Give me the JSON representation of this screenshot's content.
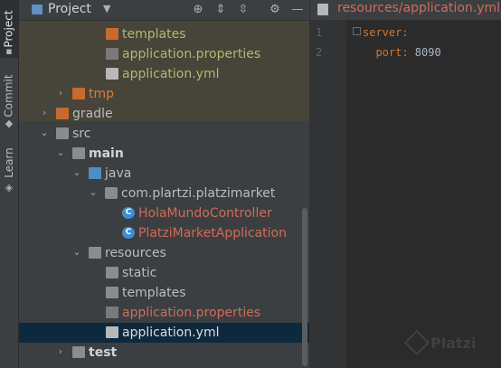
{
  "sidebar_tabs": [
    {
      "label": "Project",
      "active": true
    },
    {
      "label": "Commit",
      "active": false
    },
    {
      "label": "Learn",
      "active": false
    }
  ],
  "panel": {
    "title": "Project",
    "toolbar": [
      "locate-icon",
      "expand-all-icon",
      "collapse-all-icon",
      "gear-icon",
      "hide-icon"
    ]
  },
  "tree": [
    {
      "label": "templates",
      "kind": "folder-orange",
      "color": "olive"
    },
    {
      "label": "application.properties",
      "kind": "props",
      "color": "olive"
    },
    {
      "label": "application.yml",
      "kind": "yml",
      "color": "olive"
    },
    {
      "label": "tmp",
      "kind": "folder-orange",
      "color": "orange"
    },
    {
      "label": "gradle",
      "kind": "folder-orange",
      "color": "normal"
    },
    {
      "label": "src",
      "kind": "folder-gray",
      "color": "normal"
    },
    {
      "label": "main",
      "kind": "folder-blue",
      "color": "bold"
    },
    {
      "label": "java",
      "kind": "folder-blue",
      "color": "normal"
    },
    {
      "label": "com.plartzi.platzimarket",
      "kind": "package",
      "color": "normal"
    },
    {
      "label": "HolaMundoController",
      "kind": "class",
      "color": "red"
    },
    {
      "label": "PlatziMarketApplication",
      "kind": "class-run",
      "color": "red"
    },
    {
      "label": "resources",
      "kind": "folder-res",
      "color": "normal"
    },
    {
      "label": "static",
      "kind": "folder-gray",
      "color": "normal"
    },
    {
      "label": "templates",
      "kind": "folder-gray",
      "color": "normal"
    },
    {
      "label": "application.properties",
      "kind": "props",
      "color": "red"
    },
    {
      "label": "application.yml",
      "kind": "yml",
      "color": "white"
    },
    {
      "label": "test",
      "kind": "folder-gray",
      "color": "bold"
    }
  ],
  "editor": {
    "tab_label": "resources/application.yml",
    "lines": [
      {
        "num": "1",
        "key": "server:",
        "value": ""
      },
      {
        "num": "2",
        "key": "  port:",
        "value": " 8090"
      }
    ]
  },
  "watermark": "Platzi"
}
